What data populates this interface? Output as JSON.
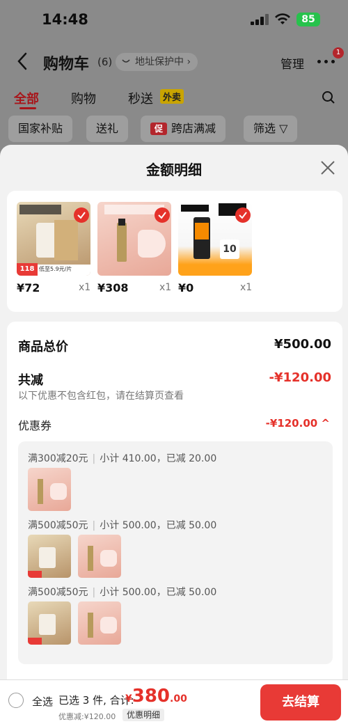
{
  "status": {
    "time": "14:48",
    "battery": "85"
  },
  "nav": {
    "title": "购物车",
    "count": "(6)",
    "address_pill": "地址保护中",
    "manage": "管理",
    "badge": "1"
  },
  "tabs": [
    {
      "label": "全部",
      "active": true
    },
    {
      "label": "购物",
      "active": false
    },
    {
      "label": "秒送",
      "active": false
    }
  ],
  "tab_tag": "外卖",
  "chips": [
    "国家补贴",
    "送礼",
    "跨店满减",
    "筛选"
  ],
  "chip_cu": "促",
  "sheet": {
    "title": "金额明细",
    "products": [
      {
        "price": "¥72",
        "qty": "x1",
        "color": "#c9a46a",
        "tag": "118",
        "sub": "低至5.9元/片"
      },
      {
        "price": "¥308",
        "qty": "x1",
        "color": "#f0c2b4",
        "tag": "",
        "sub": ""
      },
      {
        "price": "¥0",
        "qty": "x1",
        "color": "#f1a224",
        "tag": "10",
        "sub": ""
      }
    ],
    "total_label": "商品总价",
    "total_value": "¥500.00",
    "discount_label": "共减",
    "discount_value": "-¥120.00",
    "note": "以下优惠不包含红包，请在结算页查看",
    "coupon_label": "优惠券",
    "coupon_value": "-¥120.00",
    "coupon_groups": [
      {
        "rule": "满300减20元",
        "subtotal": "小计 410.00，已减 20.00",
        "thumbs": [
          "ysl"
        ]
      },
      {
        "rule": "满500减50元",
        "subtotal": "小计 500.00，已减 50.00",
        "thumbs": [
          "mask",
          "ysl"
        ]
      },
      {
        "rule": "满500减50元",
        "subtotal": "小计 500.00，已减 50.00",
        "thumbs": [
          "mask",
          "ysl"
        ]
      }
    ]
  },
  "bottom": {
    "select_all": "全选",
    "selected": "已选 3 件, 合计:",
    "currency": "¥",
    "total_int": "380",
    "total_dec": ".00",
    "savings": "优惠减:¥120.00",
    "detail": "优惠明细",
    "checkout": "去结算"
  }
}
